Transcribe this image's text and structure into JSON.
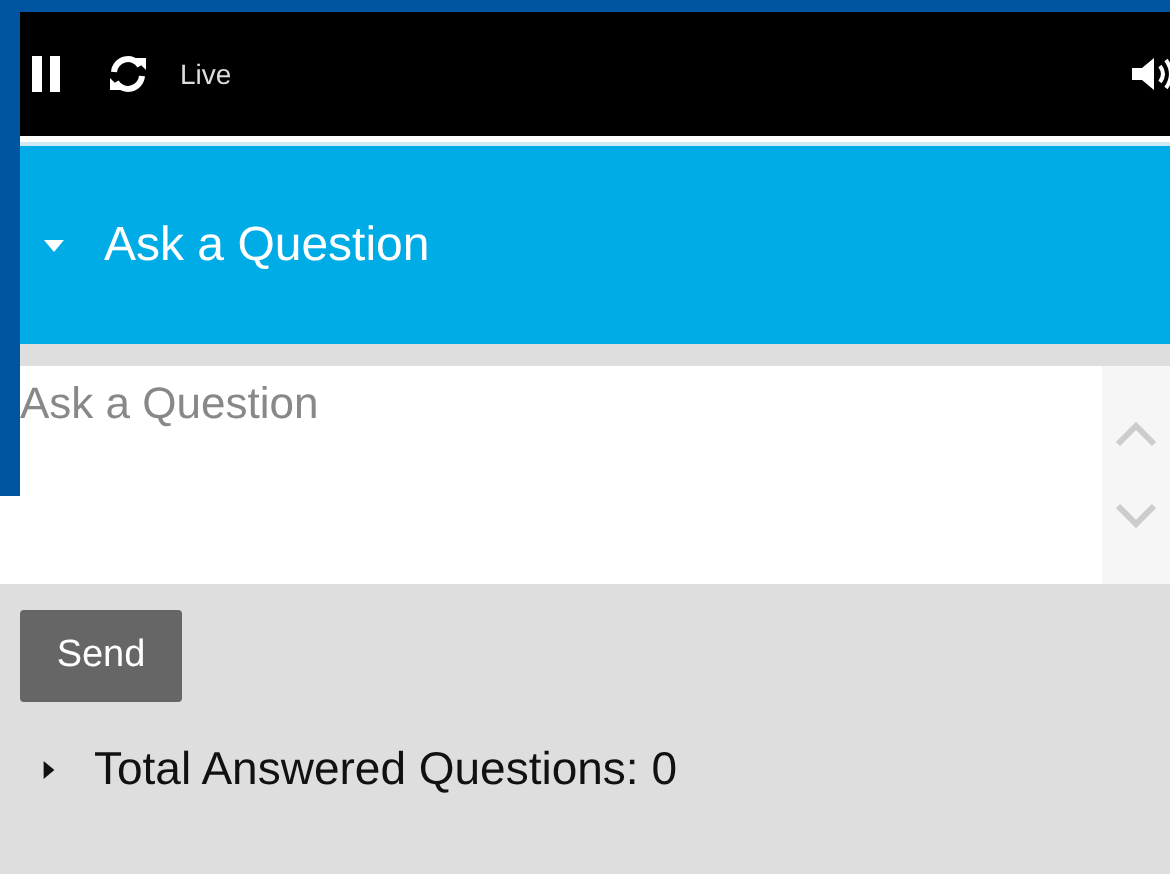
{
  "player_bar": {
    "live_label": "Live"
  },
  "question_panel": {
    "title": "Ask a Question",
    "expanded": true
  },
  "question_field": {
    "placeholder": "Ask a Question"
  },
  "send_button": "Send",
  "answered_section": {
    "label": "Total Answered Questions: 0",
    "expanded": false
  }
}
